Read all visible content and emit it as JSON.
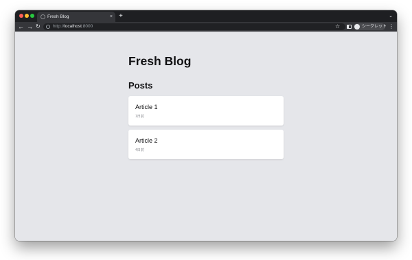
{
  "browser": {
    "tab_title": "Fresh Blog",
    "tab_close": "×",
    "new_tab": "+",
    "tab_search": "⌄",
    "url_prefix": "http://",
    "url_host": "localhost",
    "url_port": ":8000",
    "profile_label": "シークレット",
    "icons": {
      "back": "arrow-left-icon",
      "forward": "arrow-right-icon",
      "reload": "reload-icon",
      "site_info": "info-icon",
      "bookmark": "star-icon",
      "side_panel": "side-panel-icon",
      "profile": "incognito-icon",
      "menu": "kebab-menu-icon"
    },
    "glyphs": {
      "back": "←",
      "forward": "→",
      "reload": "↻",
      "bookmark": "☆",
      "menu": "⋮"
    }
  },
  "page": {
    "title": "Fresh Blog",
    "section_heading": "Posts",
    "posts": [
      {
        "title": "Article 1",
        "date": "1日前"
      },
      {
        "title": "Article 2",
        "date": "4日前"
      }
    ]
  },
  "colors": {
    "page_background": "#e5e6ea",
    "card_background": "#ffffff",
    "text": "#111113",
    "chrome_dark": "#1e1f22",
    "chrome_toolbar": "#35363a"
  }
}
